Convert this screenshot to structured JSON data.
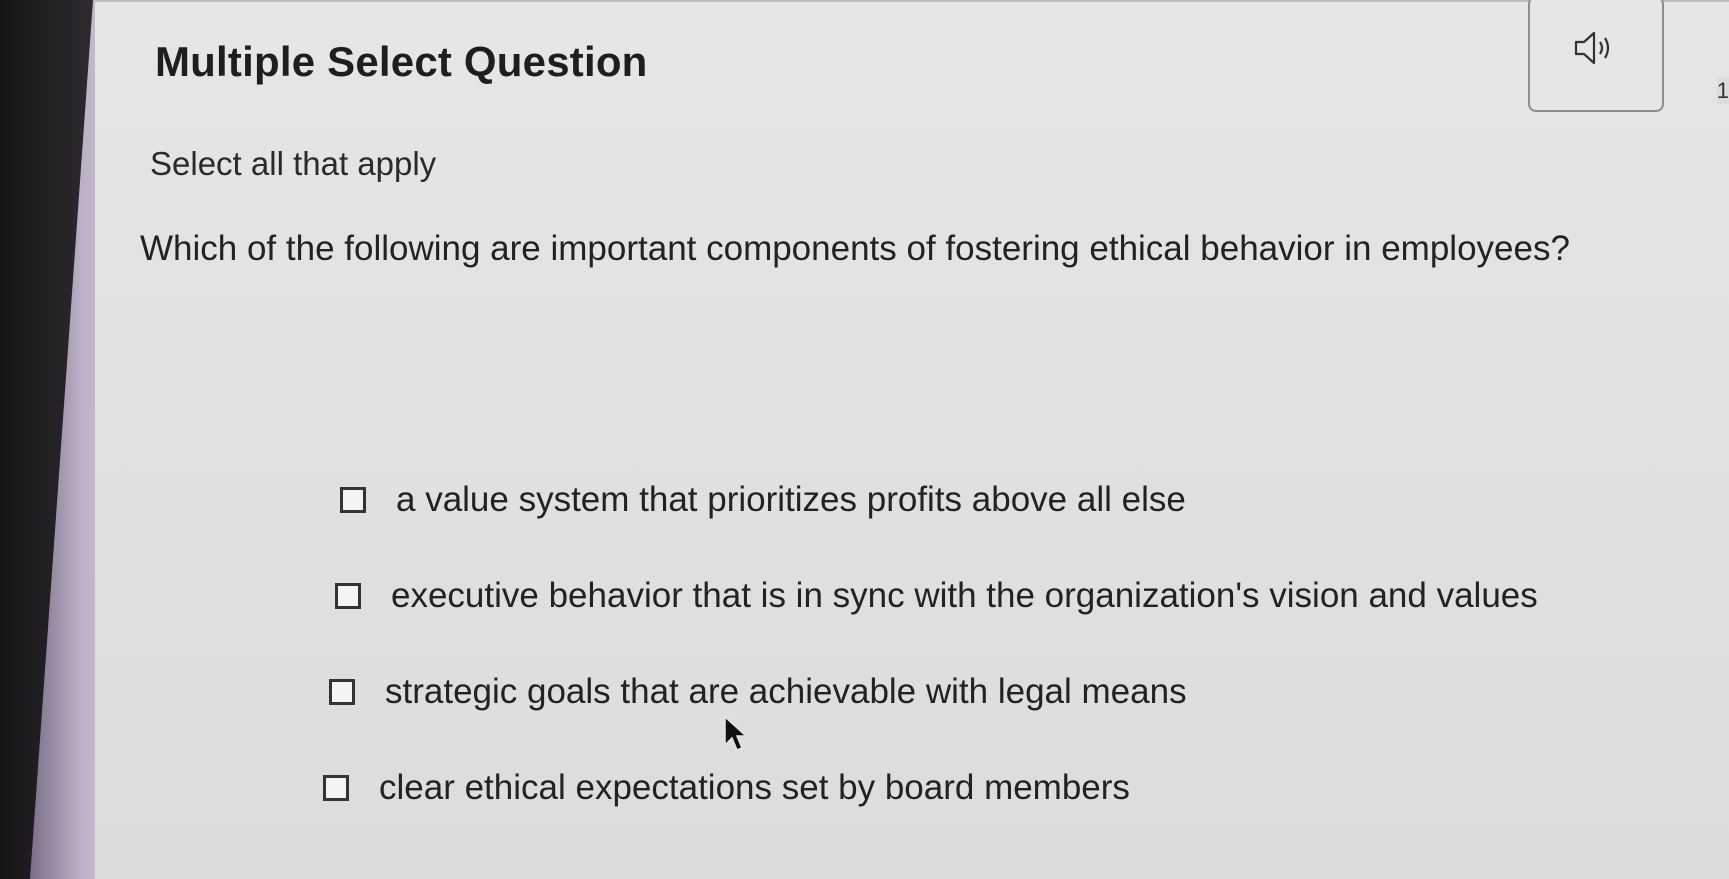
{
  "header": {
    "title": "Multiple Select Question",
    "audio_icon": "speaker-icon",
    "edge_mark": "1"
  },
  "instruction": "Select all that apply",
  "question": "Which of the following are important components of fostering ethical behavior in employees?",
  "options": [
    {
      "label": "a value system that prioritizes profits above all else",
      "checked": false
    },
    {
      "label": "executive behavior that is in sync with the organization's vision and values",
      "checked": false
    },
    {
      "label": "strategic goals that are achievable with legal means",
      "checked": false
    },
    {
      "label": "clear ethical expectations set by board members",
      "checked": false
    }
  ],
  "colors": {
    "background": "#e2e2e0",
    "text": "#222222",
    "bezel": "#1c1b1d",
    "rail": "#b9aec4"
  }
}
